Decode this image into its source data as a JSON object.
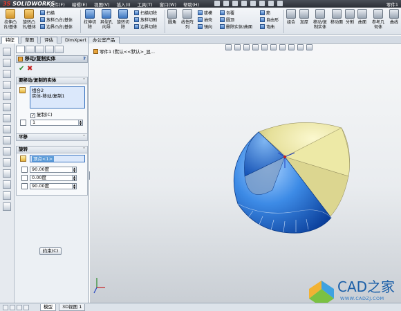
{
  "app": {
    "logo_text": "SOLIDWORKS",
    "logo_prefix": "3S",
    "title_right": "零件1"
  },
  "menus": [
    "文件(F)",
    "编辑(E)",
    "视图(V)",
    "插入(I)",
    "工具(T)",
    "窗口(W)",
    "帮助(H)"
  ],
  "ribbon": {
    "big": [
      {
        "label": "拉伸凸\n台/基体",
        "icon": "extrude-boss-icon"
      },
      {
        "label": "旋转凸\n台/基体",
        "icon": "revolve-boss-icon"
      },
      {
        "label": "拉伸切\n除",
        "icon": "extrude-cut-icon"
      },
      {
        "label": "异型孔\n向导",
        "icon": "hole-wizard-icon"
      },
      {
        "label": "旋转切\n除",
        "icon": "revolve-cut-icon"
      },
      {
        "label": "圆角",
        "icon": "fillet-icon"
      },
      {
        "label": "线性阵\n列",
        "icon": "linear-pattern-icon"
      },
      {
        "label": "组合",
        "icon": "combine-icon"
      },
      {
        "label": "加厚",
        "icon": "thicken-icon"
      },
      {
        "label": "移动/复\n制实体",
        "icon": "move-copy-icon"
      },
      {
        "label": "移动面",
        "icon": "move-face-icon"
      },
      {
        "label": "分割",
        "icon": "split-icon"
      },
      {
        "label": "曲面",
        "icon": "surface-icon"
      },
      {
        "label": "参考几\n何体",
        "icon": "reference-geometry-icon"
      },
      {
        "label": "曲线",
        "icon": "curves-icon"
      }
    ],
    "small": {
      "sweep": "扫描",
      "loft": "放样凸台/基体",
      "boundary": "边界凸台/基体",
      "swept_cut": "扫描切除",
      "lofted_cut": "放样切割",
      "boundary_cut": "边界切除",
      "draft": "拔模",
      "shell": "抽壳",
      "mirror": "镜向",
      "rib": "筋",
      "wrap": "包覆",
      "dome": "圆顶",
      "intersect": "相交",
      "deform": "自由形",
      "delete_body": "删除实体/曲面",
      "flex": "弯曲"
    }
  },
  "tabs": [
    "特征",
    "草图",
    "评估",
    "DimXpert",
    "办公室产品"
  ],
  "active_tab": "特征",
  "property_manager": {
    "title": "移动/复制实体",
    "help": "?",
    "ok": "✔",
    "cancel": "✖",
    "bodies_group": {
      "title": "要移动/复制的实体",
      "items": [
        "组合2",
        "实体-移动/复制1"
      ],
      "copy_label": "复制(C)",
      "copy_checked": true,
      "copies_value": "1"
    },
    "translate_group": {
      "title": "平移"
    },
    "rotate_group": {
      "title": "旋转",
      "point": "顶点<1>",
      "x": "90.00度",
      "y": "0.00度",
      "z": "90.00度"
    },
    "constraints_button": "约束(C)"
  },
  "viewport": {
    "tree_label": "零件1  (默认<<默认>_显..."
  },
  "bottom_tabs": [
    "模型",
    "3D视图 1"
  ],
  "watermark": {
    "text": "CAD之家",
    "url": "WWW.CADZJ.COM"
  }
}
